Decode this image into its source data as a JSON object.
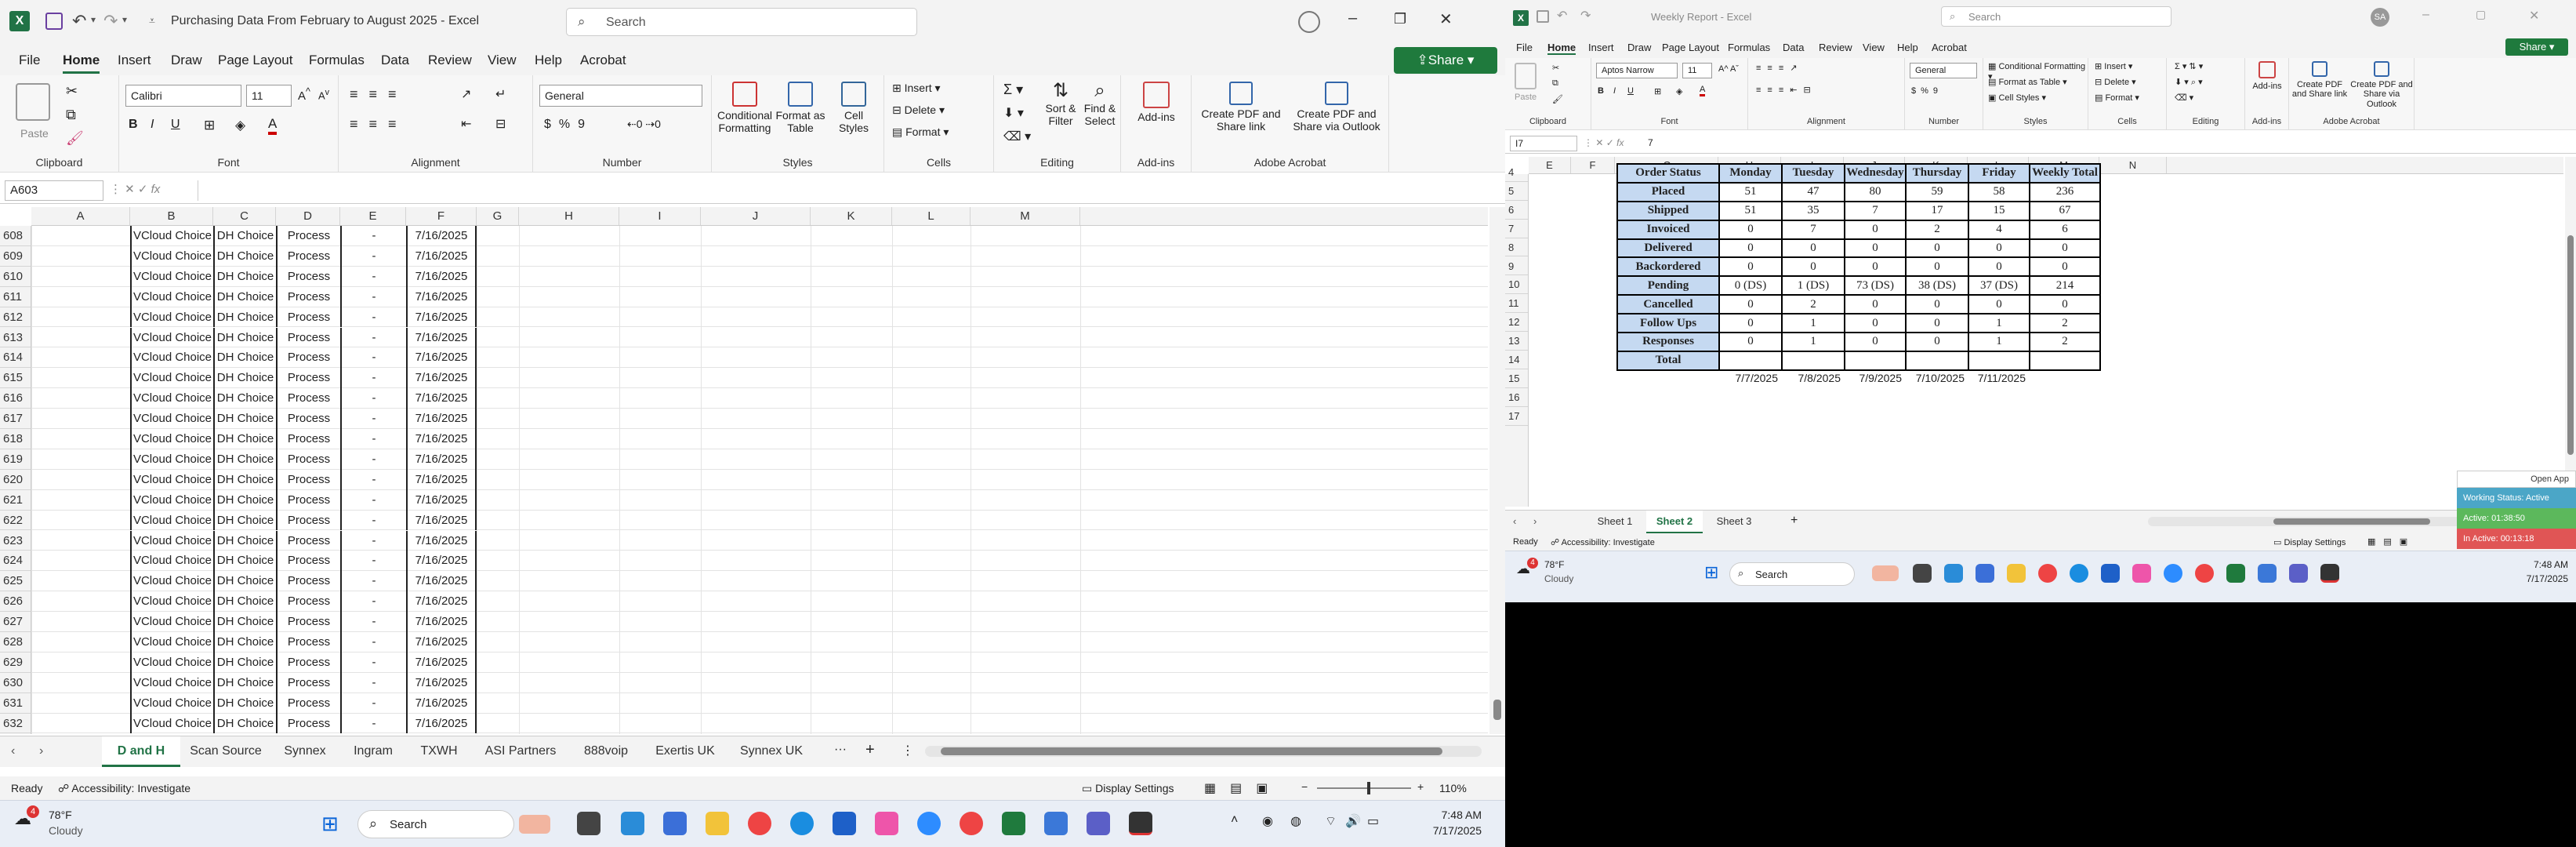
{
  "left": {
    "title": "Purchasing Data From February to August 2025",
    "app": "Excel",
    "search_placeholder": "Search",
    "share": "Share",
    "menu": [
      "File",
      "Home",
      "Insert",
      "Draw",
      "Page Layout",
      "Formulas",
      "Data",
      "Review",
      "View",
      "Help",
      "Acrobat"
    ],
    "ribbon": {
      "paste": "Paste",
      "font": "Calibri",
      "size": "11",
      "number_format": "General",
      "cond": "Conditional Formatting",
      "fmt_table": "Format as Table",
      "cell_styles": "Cell Styles",
      "insert": "Insert",
      "delete": "Delete",
      "format": "Format",
      "sort": "Sort & Filter",
      "find": "Find & Select",
      "addins": "Add-ins",
      "pdf1": "Create PDF and Share link",
      "pdf2": "Create PDF and Share via Outlook",
      "groups": [
        "Clipboard",
        "Font",
        "Alignment",
        "Number",
        "Styles",
        "Cells",
        "Editing",
        "Add-ins",
        "Adobe Acrobat"
      ]
    },
    "namebox": "A603",
    "columns": [
      "A",
      "B",
      "C",
      "D",
      "E",
      "F",
      "G",
      "H",
      "I",
      "J",
      "K",
      "L",
      "M"
    ],
    "rows": [
      "608",
      "609",
      "610",
      "611",
      "612",
      "613",
      "614",
      "615",
      "616",
      "617",
      "618",
      "619",
      "620",
      "621",
      "622",
      "623",
      "624",
      "625",
      "626",
      "627",
      "628",
      "629",
      "630",
      "631",
      "632"
    ],
    "row_values": {
      "b": "VCloud Choice",
      "c": "DH Choice",
      "d": "Process",
      "e": "-",
      "f": "7/16/2025"
    },
    "sheets": [
      "D and H",
      "Scan Source",
      "Synnex",
      "Ingram",
      "TXWH",
      "ASI Partners",
      "888voip",
      "Exertis UK",
      "Synnex UK"
    ],
    "status": {
      "ready": "Ready",
      "access": "Accessibility: Investigate",
      "display": "Display Settings",
      "zoom": "110%"
    },
    "taskbar": {
      "temp": "78°F",
      "weather": "Cloudy",
      "badge": "4",
      "search": "Search",
      "time": "7:48 AM",
      "date": "7/17/2025"
    }
  },
  "right": {
    "title": "Weekly Report - Excel",
    "search_placeholder": "Search",
    "avatar": "SA",
    "share": "Share",
    "menu": [
      "File",
      "Home",
      "Insert",
      "Draw",
      "Page Layout",
      "Formulas",
      "Data",
      "Review",
      "View",
      "Help",
      "Acrobat"
    ],
    "ribbon": {
      "font": "Aptos Narrow",
      "size": "11",
      "number_format": "General",
      "cond": "Conditional Formatting",
      "fmt_table": "Format as Table",
      "cell_styles": "Cell Styles",
      "insert": "Insert",
      "delete": "Delete",
      "format": "Format",
      "addins": "Add-ins",
      "pdf1": "Create PDF and Share link",
      "pdf2": "Create PDF and Share via Outlook",
      "paste": "Paste",
      "groups": [
        "Clipboard",
        "Font",
        "Alignment",
        "Number",
        "Styles",
        "Cells",
        "Editing",
        "Add-ins",
        "Adobe Acrobat"
      ]
    },
    "namebox": "I7",
    "formula": "7",
    "columns": [
      "E",
      "F",
      "G",
      "H",
      "I",
      "J",
      "K",
      "L",
      "M",
      "N"
    ],
    "rows": [
      "4",
      "5",
      "6",
      "7",
      "8",
      "9",
      "10",
      "11",
      "12",
      "13",
      "14",
      "15",
      "16",
      "17"
    ],
    "table": {
      "header": [
        "Order Status",
        "Monday",
        "Tuesday",
        "Wednesday",
        "Thursday",
        "Friday",
        "Weekly Total"
      ],
      "rows": [
        [
          "Placed",
          "51",
          "47",
          "80",
          "59",
          "58",
          "236"
        ],
        [
          "Shipped",
          "51",
          "35",
          "7",
          "17",
          "15",
          "67"
        ],
        [
          "Invoiced",
          "0",
          "7",
          "0",
          "2",
          "4",
          "6"
        ],
        [
          "Delivered",
          "0",
          "0",
          "0",
          "0",
          "0",
          "0"
        ],
        [
          "Backordered",
          "0",
          "0",
          "0",
          "0",
          "0",
          "0"
        ],
        [
          "Pending",
          "0 (DS)",
          "1 (DS)",
          "73 (DS)",
          "38 (DS)",
          "37 (DS)",
          "214"
        ],
        [
          "Cancelled",
          "0",
          "2",
          "0",
          "0",
          "0",
          "0"
        ],
        [
          "Follow Ups",
          "0",
          "1",
          "0",
          "0",
          "1",
          "2"
        ],
        [
          "Responses",
          "0",
          "1",
          "0",
          "0",
          "1",
          "2"
        ],
        [
          "Total",
          "",
          "",
          "",
          "",
          "",
          ""
        ]
      ],
      "dates": [
        "7/7/2025",
        "7/8/2025",
        "7/9/2025",
        "7/10/2025",
        "7/11/2025"
      ]
    },
    "sheets": [
      "Sheet 1",
      "Sheet 2",
      "Sheet 3"
    ],
    "status": {
      "ready": "Ready",
      "access": "Accessibility: Investigate",
      "display": "Display Settings"
    },
    "widget": {
      "open": "Open App",
      "working": "Working Status: Active",
      "active": "Active: 01:38:50",
      "inactive": "In Active: 00:13:18"
    },
    "taskbar": {
      "temp": "78°F",
      "weather": "Cloudy",
      "badge": "4",
      "search": "Search",
      "time": "7:48 AM",
      "date": "7/17/2025"
    }
  },
  "colors": {
    "excel_green": "#217346",
    "table_header": "#c5d9f1",
    "share_green": "#1f7a3d",
    "tab_active": "#217346"
  }
}
